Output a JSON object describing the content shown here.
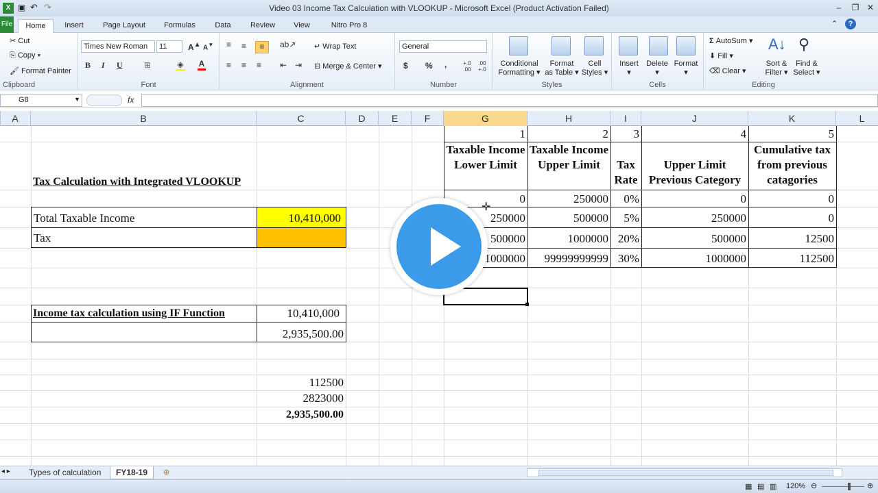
{
  "window": {
    "title": "Video 03 Income Tax Calculation with VLOOKUP  -  Microsoft Excel (Product Activation Failed)"
  },
  "tabs": [
    {
      "label": "File"
    },
    {
      "label": "Home"
    },
    {
      "label": "Insert"
    },
    {
      "label": "Page Layout"
    },
    {
      "label": "Formulas"
    },
    {
      "label": "Data"
    },
    {
      "label": "Review"
    },
    {
      "label": "View"
    },
    {
      "label": "Nitro Pro 8"
    }
  ],
  "ribbon": {
    "clipboard": {
      "cut": "Cut",
      "copy": "Copy",
      "format_painter": "Format Painter",
      "label": "Clipboard"
    },
    "font": {
      "name": "Times New Roman",
      "size": "11",
      "bold": "B",
      "italic": "I",
      "underline": "U",
      "font_color": "A",
      "label": "Font"
    },
    "alignment": {
      "wrap": "Wrap Text",
      "merge": "Merge & Center",
      "label": "Alignment"
    },
    "number": {
      "format": "General",
      "currency": "$",
      "percent": "%",
      "comma": ",",
      "inc_dec": "+.0 .00",
      "dec_dec": ".00 +.0",
      "label": "Number"
    },
    "styles": {
      "conditional": "Conditional",
      "conditional2": "Formatting",
      "table": "Format",
      "table2": "as Table",
      "cell": "Cell",
      "cell2": "Styles",
      "label": "Styles"
    },
    "cells": {
      "insert": "Insert",
      "delete": "Delete",
      "format": "Format",
      "label": "Cells"
    },
    "editing": {
      "autosum": "AutoSum",
      "fill": "Fill",
      "clear": "Clear",
      "sort": "Sort &",
      "sort2": "Filter",
      "find": "Find &",
      "find2": "Select",
      "label": "Editing"
    }
  },
  "formula_bar": {
    "name_box": "G8",
    "fx": "fx",
    "formula": ""
  },
  "columns": [
    "A",
    "B",
    "C",
    "D",
    "E",
    "F",
    "G",
    "H",
    "I",
    "J",
    "K",
    "L"
  ],
  "sheet": {
    "title1": "Tax Calculation with Integrated VLOOKUP",
    "total_label": "Total Taxable Income",
    "total_value": "10,410,000",
    "tax_label": "Tax",
    "tax_value": "",
    "title2": "Income tax calculation using IF Function",
    "if_income": "10,410,000",
    "if_tax": "2,935,500.00",
    "calc1": "112500",
    "calc2": "2823000",
    "calc_total": "2,935,500.00",
    "col_index": [
      "1",
      "2",
      "3",
      "4",
      "5"
    ],
    "table_headers": [
      "Taxable Income Lower Limit",
      "Taxable Income Upper Limit",
      "Tax Rate",
      "Upper Limit Previous Category",
      "Cumulative tax from previous catagories"
    ],
    "rows": [
      [
        "0",
        "250000",
        "0%",
        "0",
        "0"
      ],
      [
        "250000",
        "500000",
        "5%",
        "250000",
        "0"
      ],
      [
        "500000",
        "1000000",
        "20%",
        "500000",
        "12500"
      ],
      [
        "1000000",
        "99999999999",
        "30%",
        "1000000",
        "112500"
      ]
    ]
  },
  "sheet_tabs": [
    {
      "label": "Types of calculation"
    },
    {
      "label": "FY18-19"
    }
  ],
  "status": {
    "zoom": "120%"
  },
  "colors": {
    "yellow": "#ffff00",
    "orange": "#ffc000",
    "play": "#3b9be8"
  }
}
